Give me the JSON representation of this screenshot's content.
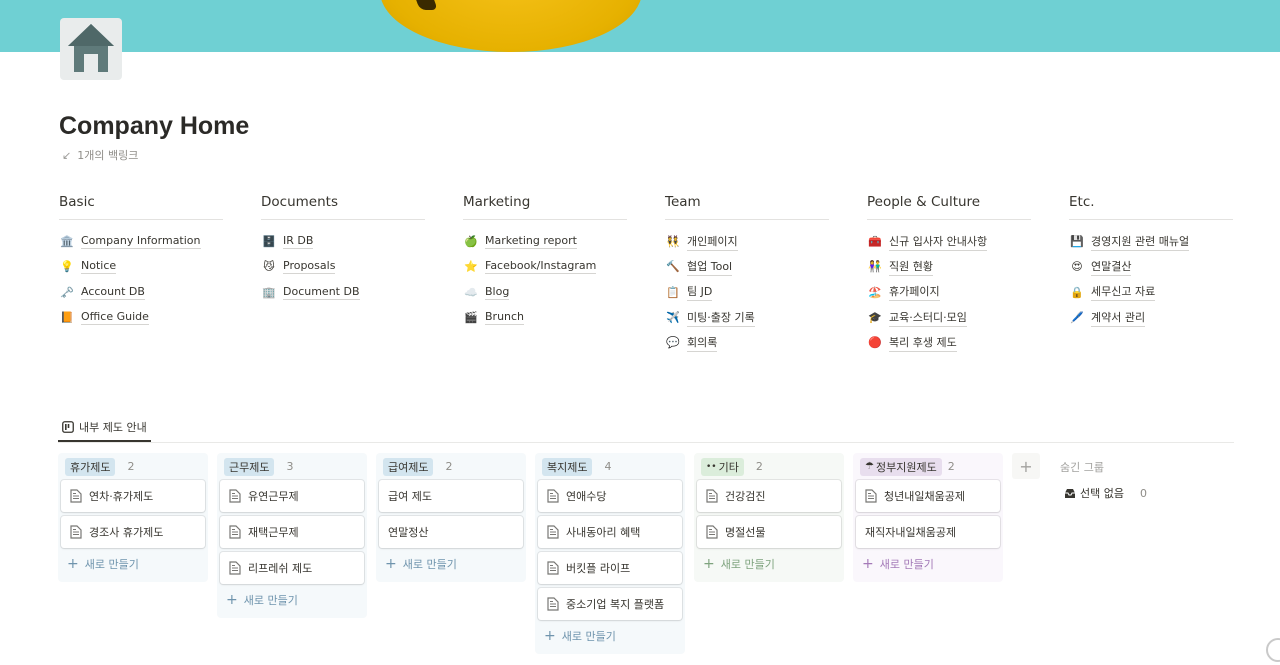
{
  "page": {
    "title": "Company Home",
    "backlinks": "1개의 백링크",
    "icon": "house-icon"
  },
  "links": [
    {
      "heading": "Basic",
      "items": [
        {
          "icon": "🏛️",
          "label": "Company Information"
        },
        {
          "icon": "💡",
          "label": "Notice"
        },
        {
          "icon": "🗝️",
          "label": "Account DB"
        },
        {
          "icon": "📙",
          "label": "Office Guide"
        }
      ]
    },
    {
      "heading": "Documents",
      "items": [
        {
          "icon": "🗄️",
          "label": "IR DB"
        },
        {
          "icon": "😼",
          "label": "Proposals"
        },
        {
          "icon": "🏢",
          "label": "Document DB"
        }
      ]
    },
    {
      "heading": "Marketing",
      "items": [
        {
          "icon": "🍏",
          "label": "Marketing report"
        },
        {
          "icon": "⭐",
          "label": "Facebook/Instagram"
        },
        {
          "icon": "☁️",
          "label": "Blog"
        },
        {
          "icon": "🎬",
          "label": "Brunch"
        }
      ]
    },
    {
      "heading": "Team",
      "items": [
        {
          "icon": "👯",
          "label": "개인페이지"
        },
        {
          "icon": "🔨",
          "label": "협업 Tool"
        },
        {
          "icon": "📋",
          "label": "팀 JD"
        },
        {
          "icon": "✈️",
          "label": "미팅·출장 기록"
        },
        {
          "icon": "💬",
          "label": "회의록"
        }
      ]
    },
    {
      "heading": "People & Culture",
      "items": [
        {
          "icon": "🧰",
          "label": "신규 입사자 안내사항"
        },
        {
          "icon": "👫",
          "label": "직원 현황"
        },
        {
          "icon": "🏖️",
          "label": "휴가페이지"
        },
        {
          "icon": "🎓",
          "label": "교육·스터디·모임"
        },
        {
          "icon": "🔴",
          "label": "복리 후생 제도"
        }
      ]
    },
    {
      "heading": "Etc.",
      "items": [
        {
          "icon": "💾",
          "label": "경영지원 관련 매뉴얼"
        },
        {
          "icon": "😍",
          "label": "연말결산"
        },
        {
          "icon": "🔒",
          "label": "세무신고 자료"
        },
        {
          "icon": "🖊️",
          "label": "계약서 관리"
        }
      ]
    }
  ],
  "database": {
    "tab_label": "내부 제도 안내",
    "new_label": "새로 만들기",
    "colors": {
      "blue_bg": "#f5f9fb",
      "blue_tag": "#d3e5ef",
      "green_bg": "#f6f9f6",
      "green_tag": "#dbeddb",
      "purple_bg": "#faf7fc",
      "purple_tag": "#e8deee"
    },
    "groups": [
      {
        "name": "휴가제도",
        "count": "2",
        "cards": [
          "연차·휴가제도",
          "경조사 휴가제도"
        ]
      },
      {
        "name": "근무제도",
        "count": "3",
        "cards": [
          "유연근무제",
          "재택근무제",
          "리프레쉬 제도"
        ]
      },
      {
        "name": "급여제도",
        "count": "2",
        "cards": [
          "급여 제도",
          "연말정산"
        ]
      },
      {
        "name": "복지제도",
        "count": "4",
        "cards": [
          "연애수당",
          "사내동아리 혜택",
          "버킷플 라이프",
          "중소기업 복지 플랫폼"
        ]
      },
      {
        "name": "기타",
        "count": "2",
        "cards": [
          "건강검진",
          "명절선물"
        ]
      },
      {
        "name": "정부지원제도",
        "count": "2",
        "cards": [
          "청년내일채움공제",
          "재직자내일채움공제"
        ]
      }
    ],
    "hidden_groups": {
      "title": "숨긴 그룹",
      "item_label": "선택 없음",
      "item_count": "0"
    }
  }
}
